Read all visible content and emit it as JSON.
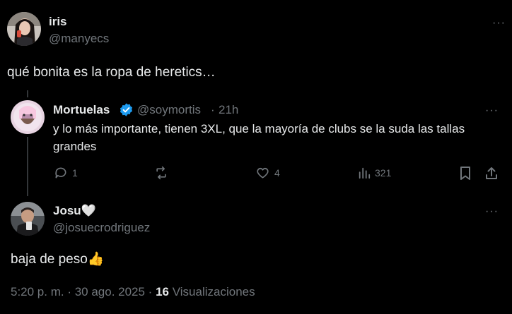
{
  "post": {
    "author_name": "iris",
    "author_handle": "@manyecs",
    "text": "qué bonita es la ropa de heretics…",
    "more_label": "···"
  },
  "reply1": {
    "author_name": "Mortuelas",
    "author_handle": "@soymortis",
    "separator": "·",
    "time": "21h",
    "text": "y lo más importante, tienen 3XL, que la mayoría de clubs se la suda las tallas grandes",
    "more_label": "···",
    "actions": {
      "reply_count": "1",
      "repost_count": "",
      "like_count": "4",
      "views_count": "321"
    }
  },
  "reply2": {
    "author_name": "Josu🤍",
    "author_handle": "@josuecrodriguez",
    "text": "baja de peso👍",
    "more_label": "···",
    "timestamp": "5:20 p. m. · 30 ago. 2025 ·",
    "views_count": "16",
    "views_label": "Visualizaciones"
  },
  "colors": {
    "background": "#000000",
    "text": "#e7e9ea",
    "muted": "#71767b",
    "verified": "#1d9bf0",
    "thread_line": "#333639"
  },
  "icons": [
    "reply-icon",
    "repost-icon",
    "like-icon",
    "views-icon",
    "bookmark-icon",
    "share-icon",
    "verified-badge-icon",
    "more-icon"
  ]
}
